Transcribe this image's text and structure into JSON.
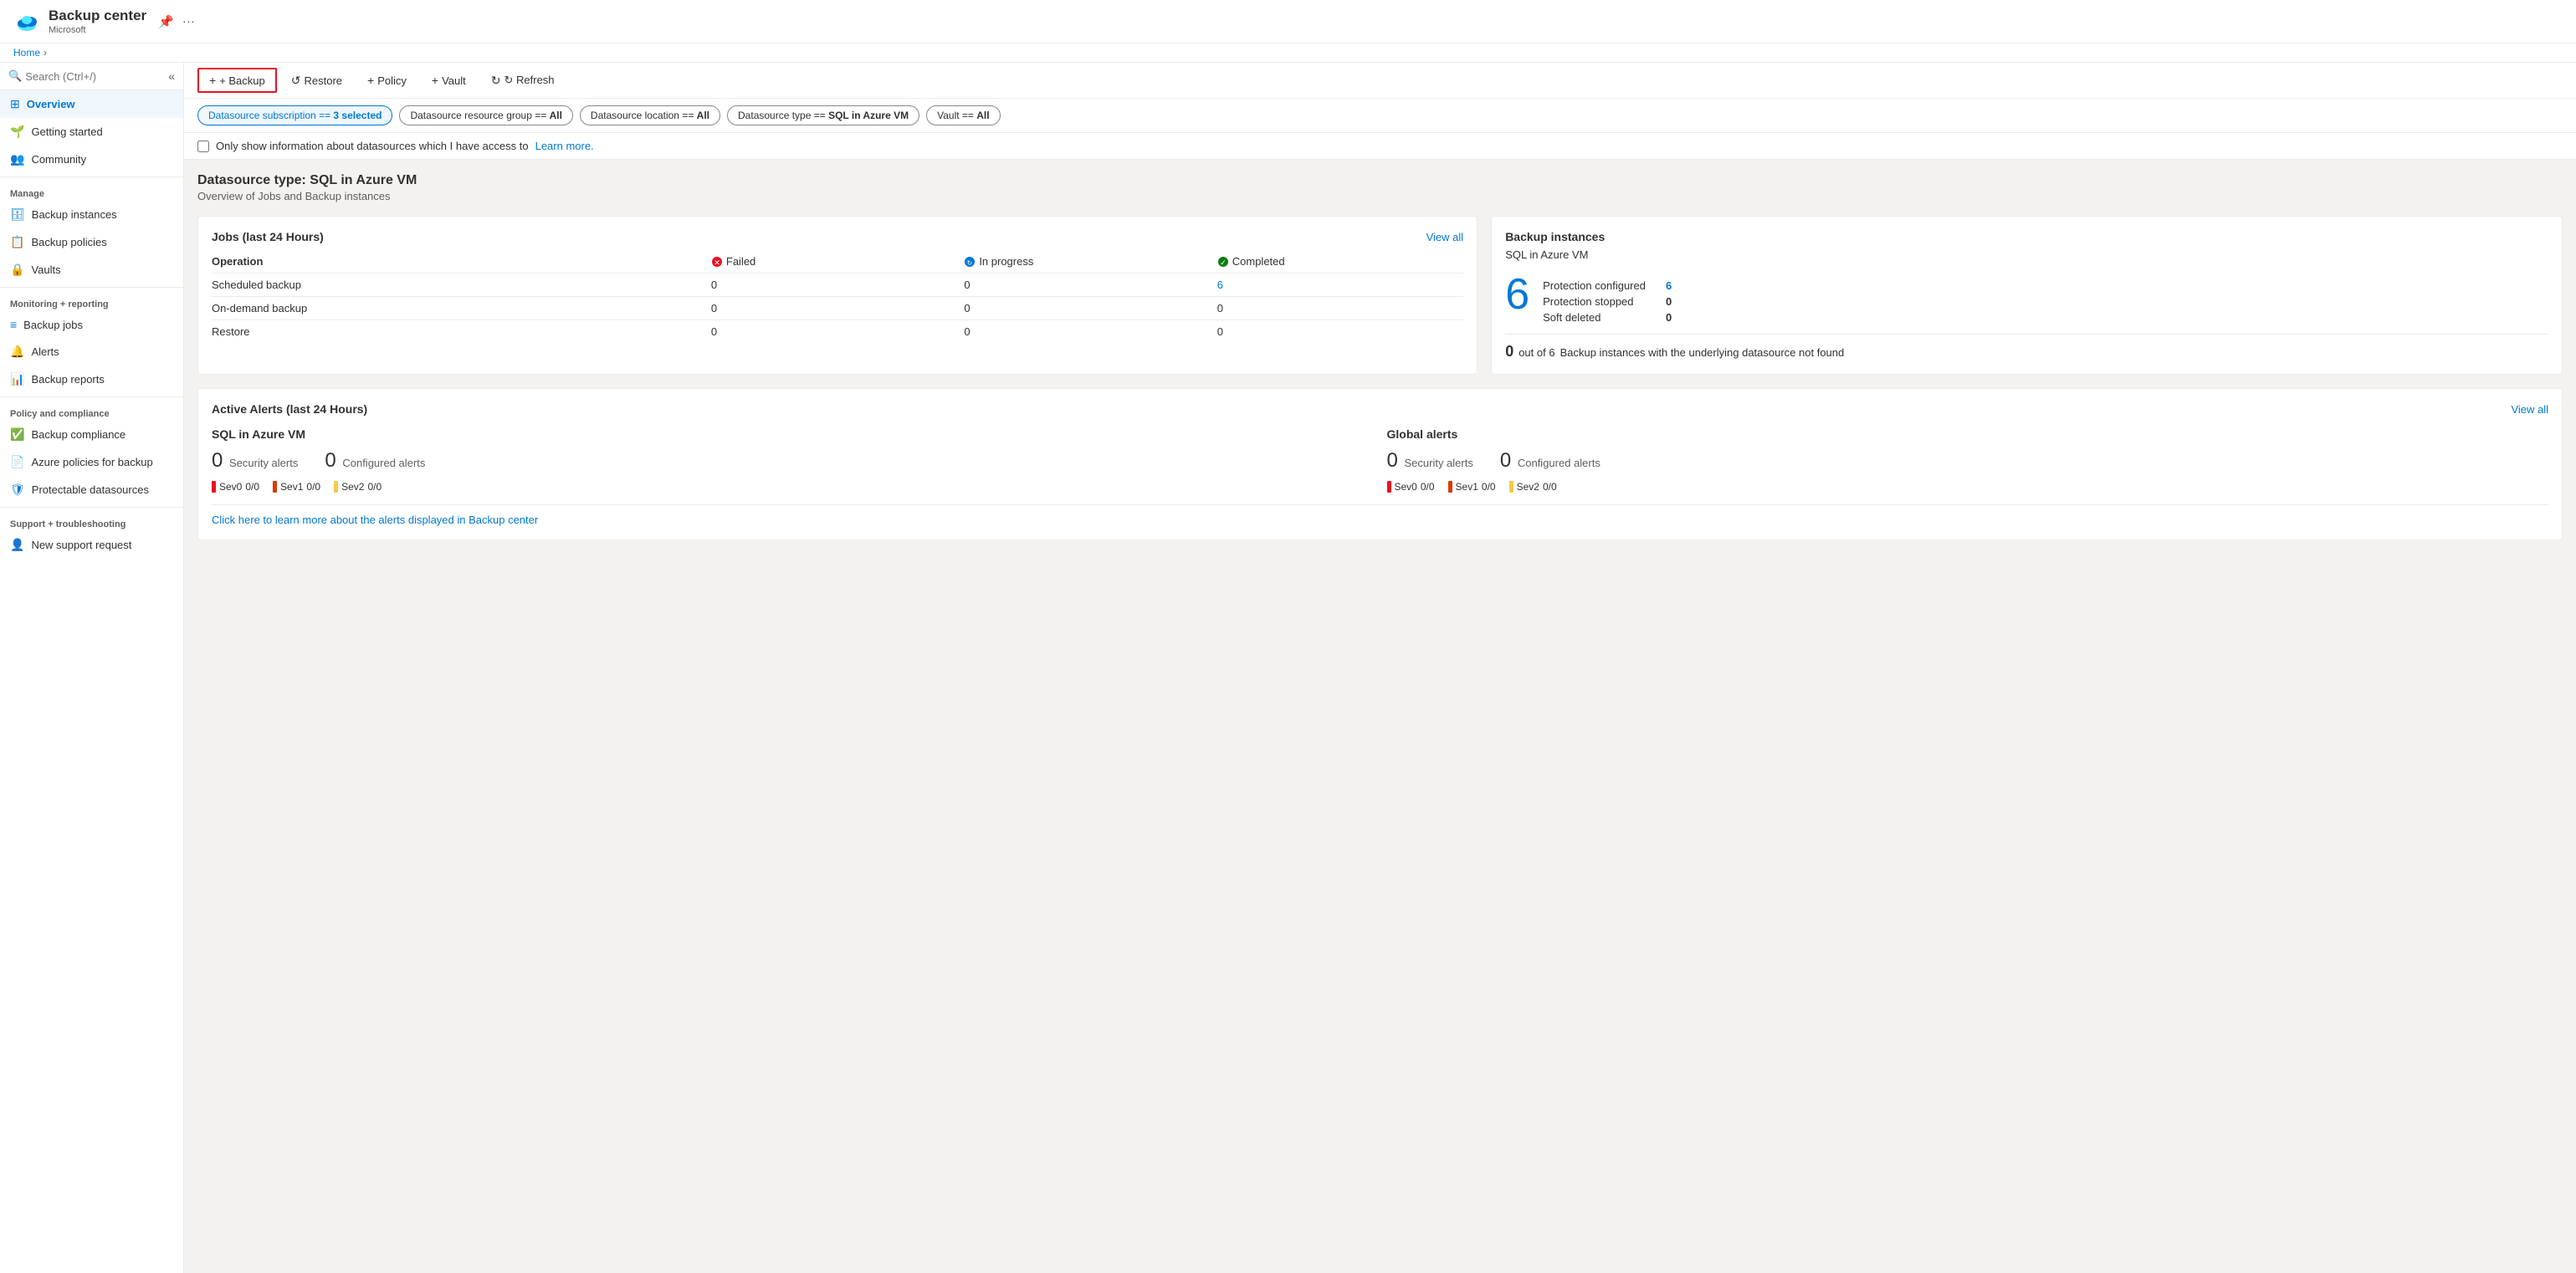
{
  "app": {
    "title": "Backup center",
    "subtitle": "Microsoft",
    "breadcrumb_home": "Home"
  },
  "sidebar": {
    "search_placeholder": "Search (Ctrl+/)",
    "collapse_tooltip": "Collapse",
    "items_top": [
      {
        "id": "overview",
        "label": "Overview",
        "active": true,
        "icon": "overview-icon"
      },
      {
        "id": "getting-started",
        "label": "Getting started",
        "active": false,
        "icon": "getting-started-icon"
      },
      {
        "id": "community",
        "label": "Community",
        "active": false,
        "icon": "community-icon"
      }
    ],
    "manage_label": "Manage",
    "items_manage": [
      {
        "id": "backup-instances",
        "label": "Backup instances",
        "active": false,
        "icon": "backup-instances-icon"
      },
      {
        "id": "backup-policies",
        "label": "Backup policies",
        "active": false,
        "icon": "backup-policies-icon"
      },
      {
        "id": "vaults",
        "label": "Vaults",
        "active": false,
        "icon": "vaults-icon"
      }
    ],
    "monitoring_label": "Monitoring + reporting",
    "items_monitoring": [
      {
        "id": "backup-jobs",
        "label": "Backup jobs",
        "active": false,
        "icon": "backup-jobs-icon"
      },
      {
        "id": "alerts",
        "label": "Alerts",
        "active": false,
        "icon": "alerts-icon"
      },
      {
        "id": "backup-reports",
        "label": "Backup reports",
        "active": false,
        "icon": "backup-reports-icon"
      }
    ],
    "policy_label": "Policy and compliance",
    "items_policy": [
      {
        "id": "backup-compliance",
        "label": "Backup compliance",
        "active": false,
        "icon": "backup-compliance-icon"
      },
      {
        "id": "azure-policies",
        "label": "Azure policies for backup",
        "active": false,
        "icon": "azure-policies-icon"
      },
      {
        "id": "protectable-datasources",
        "label": "Protectable datasources",
        "active": false,
        "icon": "protectable-datasources-icon"
      }
    ],
    "support_label": "Support + troubleshooting",
    "items_support": [
      {
        "id": "new-support-request",
        "label": "New support request",
        "active": false,
        "icon": "support-icon"
      }
    ]
  },
  "toolbar": {
    "backup_label": "+ Backup",
    "restore_label": "↺ Restore",
    "policy_label": "+ Policy",
    "vault_label": "+ Vault",
    "refresh_label": "↻ Refresh"
  },
  "filters": [
    {
      "id": "subscription",
      "label": "Datasource subscription == 3 selected",
      "selected": true
    },
    {
      "id": "resource-group",
      "label": "Datasource resource group == All",
      "selected": false
    },
    {
      "id": "location",
      "label": "Datasource location == All",
      "selected": false
    },
    {
      "id": "datasource-type",
      "label": "Datasource type == SQL in Azure VM",
      "selected": false
    },
    {
      "id": "vault",
      "label": "Vault == All",
      "selected": false
    }
  ],
  "checkbox_row": {
    "label": "Only show information about datasources which I have access to",
    "learn_more": "Learn more.",
    "checked": false
  },
  "datasource_section": {
    "title": "Datasource type: SQL in Azure VM",
    "subtitle": "Overview of Jobs and Backup instances"
  },
  "jobs_card": {
    "title": "Jobs (last 24 Hours)",
    "view_all": "View all",
    "columns": [
      "Operation",
      "Failed",
      "In progress",
      "Completed"
    ],
    "col_icons": [
      "",
      "failed",
      "inprogress",
      "completed"
    ],
    "rows": [
      {
        "operation": "Scheduled backup",
        "failed": "0",
        "inprogress": "0",
        "completed": "6"
      },
      {
        "operation": "On-demand backup",
        "failed": "0",
        "inprogress": "0",
        "completed": "0"
      },
      {
        "operation": "Restore",
        "failed": "0",
        "inprogress": "0",
        "completed": "0"
      }
    ]
  },
  "backup_instances_card": {
    "title": "Backup instances",
    "subtitle": "SQL in Azure VM",
    "big_number": "6",
    "stats": [
      {
        "label": "Protection configured",
        "value": "6",
        "link": true
      },
      {
        "label": "Protection stopped",
        "value": "0",
        "link": false
      },
      {
        "label": "Soft deleted",
        "value": "0",
        "link": false
      }
    ],
    "sub_count": "0",
    "sub_of": "out of 6",
    "sub_description": "Backup instances with the underlying datasource not found"
  },
  "alerts_card": {
    "title": "Active Alerts (last 24 Hours)",
    "view_all": "View all",
    "sql_section": {
      "title": "SQL in Azure VM",
      "security_count": "0",
      "security_label": "Security alerts",
      "configured_count": "0",
      "configured_label": "Configured alerts",
      "sev": [
        {
          "label": "Sev0",
          "value": "0/0",
          "color": "red"
        },
        {
          "label": "Sev1",
          "value": "0/0",
          "color": "orange"
        },
        {
          "label": "Sev2",
          "value": "0/0",
          "color": "yellow"
        }
      ]
    },
    "global_section": {
      "title": "Global alerts",
      "security_count": "0",
      "security_label": "Security alerts",
      "configured_count": "0",
      "configured_label": "Configured alerts",
      "sev": [
        {
          "label": "Sev0",
          "value": "0/0",
          "color": "red"
        },
        {
          "label": "Sev1",
          "value": "0/0",
          "color": "orange"
        },
        {
          "label": "Sev2",
          "value": "0/0",
          "color": "yellow"
        }
      ]
    },
    "learn_more": "Click here to learn more about the alerts displayed in Backup center"
  },
  "colors": {
    "accent": "#0078d4",
    "danger": "#e81123",
    "success": "#107c10",
    "warning": "#f7c948"
  }
}
